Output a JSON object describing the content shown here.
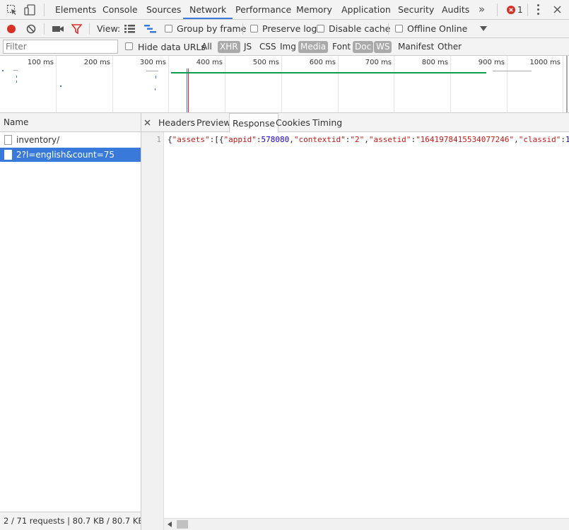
{
  "devtools": {
    "main_tabs": [
      "Elements",
      "Console",
      "Sources",
      "Network",
      "Performance",
      "Memory",
      "Application",
      "Security",
      "Audits"
    ],
    "active_tab": "Network",
    "more_tabs_glyph": "»",
    "error_count": "1"
  },
  "toolbar": {
    "view_label": "View:",
    "group_by_frame": "Group by frame",
    "preserve_log": "Preserve log",
    "disable_cache": "Disable cache",
    "offline": "Offline",
    "throttle_value": "Online"
  },
  "filterbar": {
    "placeholder": "Filter",
    "hide_data_urls": "Hide data URLs",
    "types": [
      {
        "label": "All",
        "active": false
      },
      {
        "label": "XHR",
        "active": true
      },
      {
        "label": "JS",
        "active": false
      },
      {
        "label": "CSS",
        "active": false
      },
      {
        "label": "Img",
        "active": false
      },
      {
        "label": "Media",
        "active": true
      },
      {
        "label": "Font",
        "active": false
      },
      {
        "label": "Doc",
        "active": true
      },
      {
        "label": "WS",
        "active": true
      },
      {
        "label": "Manifest",
        "active": false
      },
      {
        "label": "Other",
        "active": false
      }
    ]
  },
  "overview": {
    "ticks": [
      "100 ms",
      "200 ms",
      "300 ms",
      "400 ms",
      "500 ms",
      "600 ms",
      "700 ms",
      "800 ms",
      "900 ms",
      "1000 ms"
    ]
  },
  "requests": {
    "column_header": "Name",
    "items": [
      {
        "name": "inventory/",
        "selected": false
      },
      {
        "name": "2?l=english&count=75",
        "selected": true
      }
    ],
    "summary": "2 / 71 requests | 80.7 KB / 80.7 KB..."
  },
  "details": {
    "tabs": [
      "Headers",
      "Preview",
      "Response",
      "Cookies",
      "Timing"
    ],
    "active_tab": "Response",
    "line_number": "1",
    "response_line": "{\"assets\":[{\"appid\":578080,\"contextid\":\"2\",\"assetid\":\"1641978415534077246\",\"classid\":\"1"
  },
  "colors": {
    "accent": "#3879d9",
    "record": "#d93025",
    "filter_icon": "#d93025",
    "timeline_green": "#0a9e4a",
    "active_pill": "#aaaaaa"
  }
}
